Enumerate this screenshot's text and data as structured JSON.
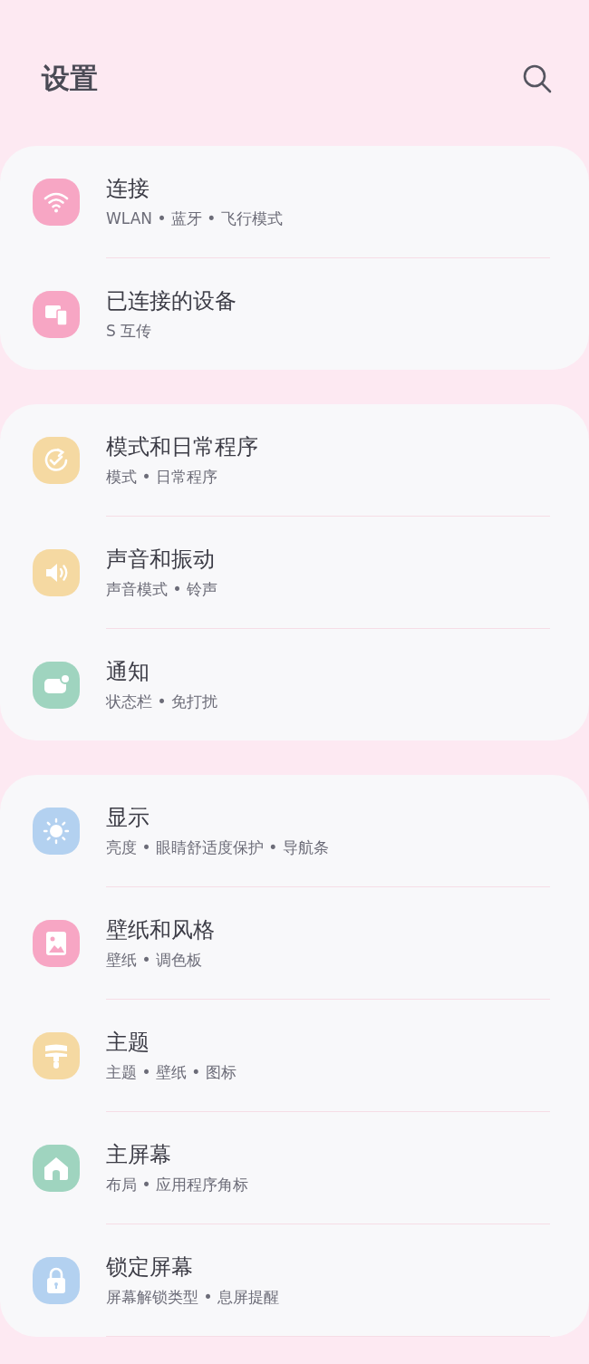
{
  "header": {
    "title": "设置"
  },
  "groups": [
    {
      "items": [
        {
          "kind": "wifi",
          "color": "#f7a6c4",
          "title": "连接",
          "subtitle": "WLAN • 蓝牙 • 飞行模式"
        },
        {
          "kind": "devices",
          "color": "#f7a6c4",
          "title": "已连接的设备",
          "subtitle": "S 互传"
        }
      ]
    },
    {
      "items": [
        {
          "kind": "routine",
          "color": "#f5d9a2",
          "title": "模式和日常程序",
          "subtitle": "模式 • 日常程序"
        },
        {
          "kind": "sound",
          "color": "#f5d9a2",
          "title": "声音和振动",
          "subtitle": "声音模式 • 铃声"
        },
        {
          "kind": "notify",
          "color": "#9fd4bf",
          "title": "通知",
          "subtitle": "状态栏 • 免打扰"
        }
      ]
    },
    {
      "items": [
        {
          "kind": "sun",
          "color": "#b3d1f0",
          "title": "显示",
          "subtitle": "亮度 • 眼睛舒适度保护 • 导航条"
        },
        {
          "kind": "image",
          "color": "#f7a6c4",
          "title": "壁纸和风格",
          "subtitle": "壁纸 • 调色板"
        },
        {
          "kind": "brush",
          "color": "#f5d9a2",
          "title": "主题",
          "subtitle": "主题 • 壁纸 • 图标"
        },
        {
          "kind": "home",
          "color": "#9fd4bf",
          "title": "主屏幕",
          "subtitle": "布局 • 应用程序角标"
        },
        {
          "kind": "lock",
          "color": "#b3d1f0",
          "title": "锁定屏幕",
          "subtitle": "屏幕解锁类型 • 息屏提醒"
        }
      ]
    }
  ]
}
